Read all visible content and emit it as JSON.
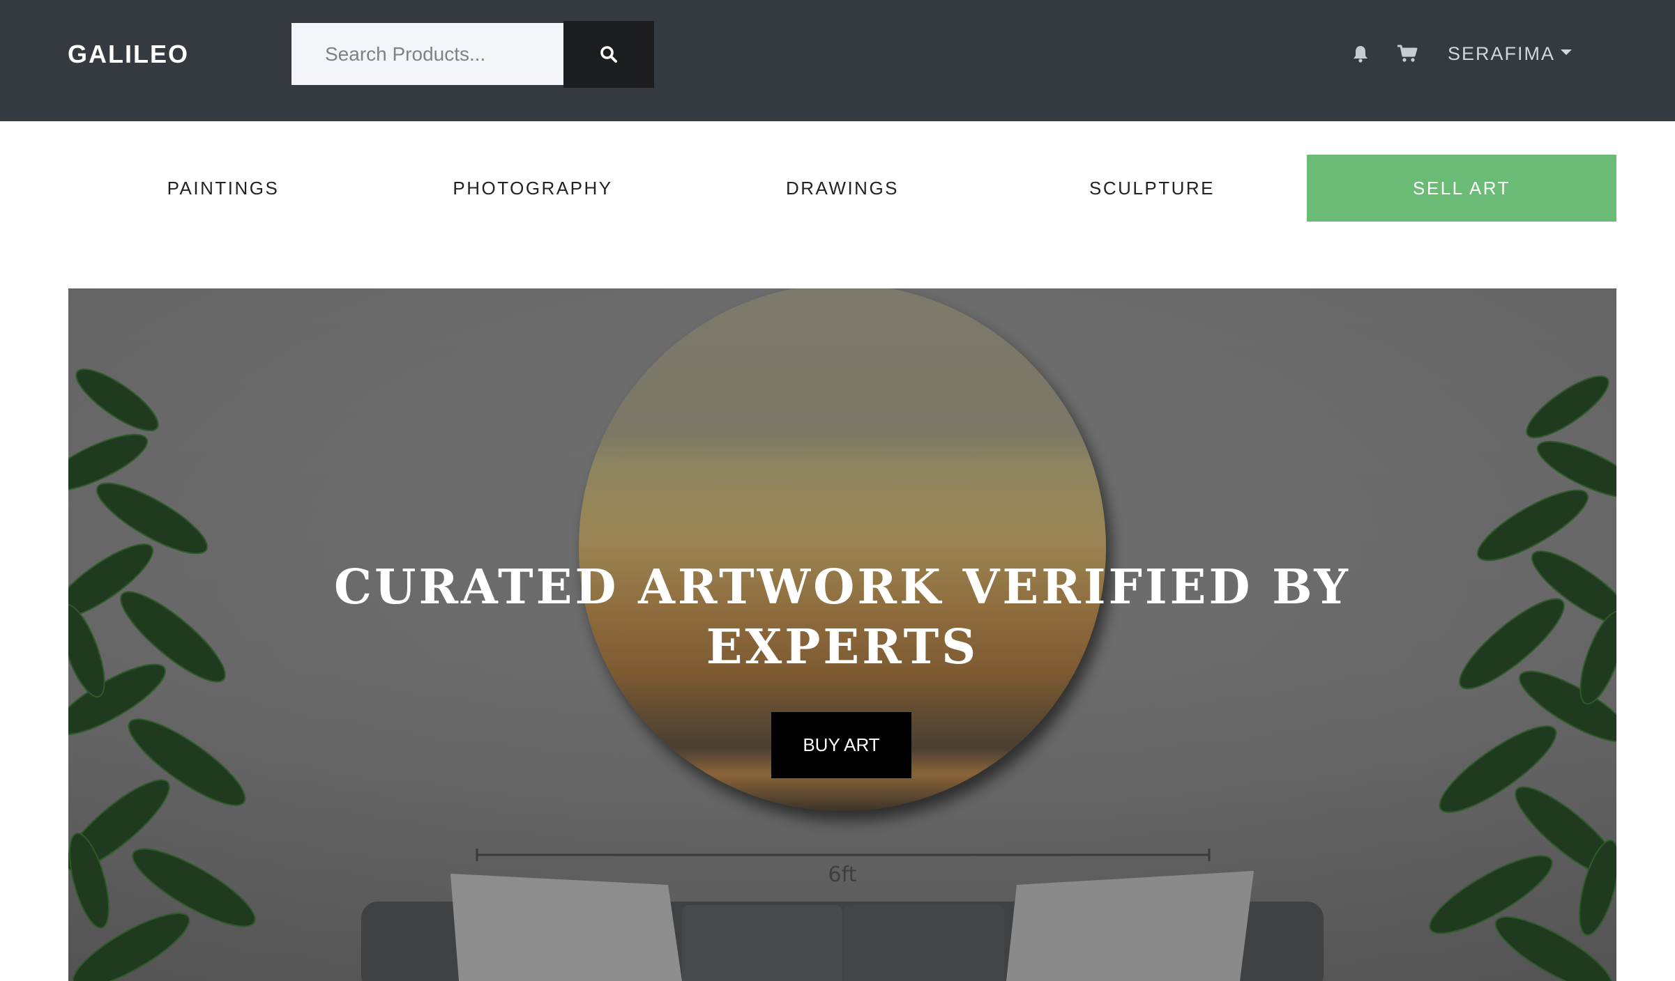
{
  "header": {
    "brand": "GALILEO",
    "search": {
      "placeholder": "Search Products..."
    },
    "icons": {
      "notifications": "bell-icon",
      "cart": "cart-icon",
      "search": "search-icon"
    },
    "user": "SERAFIMA"
  },
  "categories": [
    "PAINTINGS",
    "PHOTOGRAPHY",
    "DRAWINGS",
    "SCULPTURE",
    "SELL ART"
  ],
  "hero": {
    "title_line1": "CURATED ARTWORK VERIFIED BY",
    "title_line2": "EXPERTS",
    "cta": "BUY ART",
    "dimension_label": "6ft"
  },
  "colors": {
    "navbar": "#343a40",
    "accent": "#6abb76",
    "button": "#000000"
  }
}
